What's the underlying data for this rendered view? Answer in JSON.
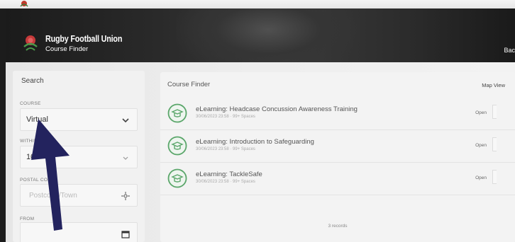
{
  "header": {
    "title": "Rugby Football Union",
    "subtitle": "Course Finder",
    "back_label": "Bac"
  },
  "search": {
    "title": "Search",
    "course_label": "COURSE",
    "course_value": "Virtual",
    "within_label": "WITHIN",
    "within_value": "10",
    "postal_label": "POSTAL CODE",
    "postal_placeholder": "Postcode/Town",
    "from_label": "FROM"
  },
  "results": {
    "title": "Course Finder",
    "map_view": "Map View",
    "rows": [
      {
        "title": "eLearning: Headcase Concussion Awareness Training",
        "meta": "30/06/2023 23:58 · 99+ Spaces",
        "action": "Open"
      },
      {
        "title": "eLearning: Introduction to Safeguarding",
        "meta": "30/06/2023 23:58 · 99+ Spaces",
        "action": "Open"
      },
      {
        "title": "eLearning: TackleSafe",
        "meta": "30/06/2023 23:58 · 99+ Spaces",
        "action": "Open"
      }
    ],
    "records": "3 records"
  },
  "colors": {
    "accent_green": "#5aa66a",
    "arrow": "#23235e",
    "header_bg": "#2a2a2a"
  },
  "icons": {
    "course": "graduation-cap-icon",
    "select": "chevron-down-icon",
    "location": "crosshair-icon",
    "date": "calendar-icon"
  }
}
